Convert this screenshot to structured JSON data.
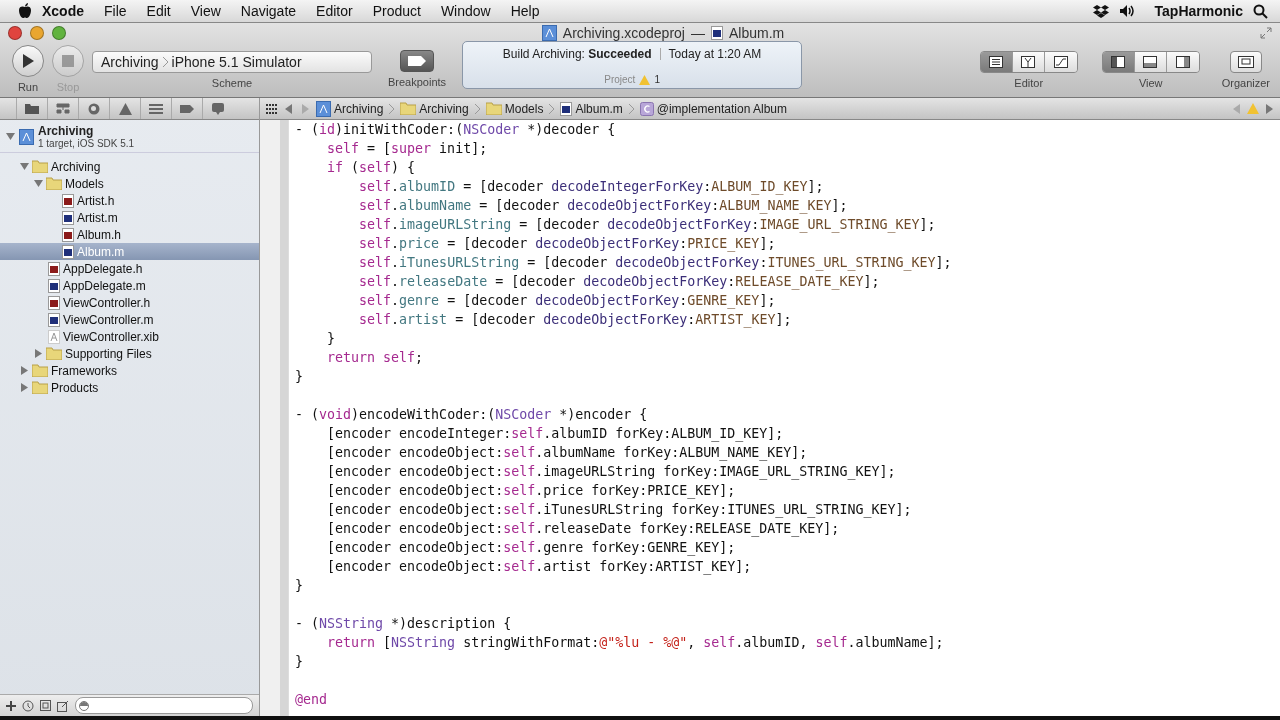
{
  "menu_bar": {
    "app": "Xcode",
    "items": [
      "File",
      "Edit",
      "View",
      "Navigate",
      "Editor",
      "Product",
      "Window",
      "Help"
    ],
    "user": "TapHarmonic"
  },
  "window": {
    "title": "Archiving.xcodeproj",
    "separator": "—",
    "file": "Album.m"
  },
  "toolbar": {
    "run": {
      "label": "Run",
      "disabled": false
    },
    "stop": {
      "label": "Stop",
      "disabled": true
    },
    "scheme": {
      "project": "Archiving",
      "destination": "iPhone 5.1 Simulator",
      "label": "Scheme"
    },
    "breakpoints": {
      "label": "Breakpoints"
    },
    "activity": {
      "prefix": "Build Archiving:",
      "status": "Succeeded",
      "time": "Today at 1:20 AM",
      "project": "Project",
      "warnings": "1"
    },
    "editor": {
      "label": "Editor",
      "segments": [
        {
          "kind": "standard",
          "selected": true
        },
        {
          "kind": "assistant",
          "selected": false
        },
        {
          "kind": "version",
          "selected": false
        }
      ]
    },
    "view": {
      "label": "View",
      "segments": [
        {
          "kind": "left",
          "selected": true
        },
        {
          "kind": "bottom",
          "selected": false
        },
        {
          "kind": "right",
          "selected": false
        }
      ]
    },
    "organizer": {
      "label": "Organizer"
    }
  },
  "jump_bar": {
    "crumbs": [
      {
        "kind": "project",
        "label": "Archiving"
      },
      {
        "kind": "folder",
        "label": "Archiving"
      },
      {
        "kind": "folder",
        "label": "Models"
      },
      {
        "kind": "m",
        "label": "Album.m"
      },
      {
        "kind": "class",
        "label": "@implementation Album"
      }
    ]
  },
  "navigator": {
    "project": {
      "name": "Archiving",
      "subtitle": "1 target, iOS SDK 5.1",
      "expanded": true
    },
    "tree": [
      {
        "kind": "folder",
        "label": "Archiving",
        "expanded": true,
        "selected": false,
        "children": [
          {
            "kind": "folder",
            "label": "Models",
            "expanded": true,
            "selected": false,
            "children": [
              {
                "kind": "h",
                "label": "Artist.h",
                "selected": false
              },
              {
                "kind": "m",
                "label": "Artist.m",
                "selected": false
              },
              {
                "kind": "h",
                "label": "Album.h",
                "selected": false
              },
              {
                "kind": "m",
                "label": "Album.m",
                "selected": true
              }
            ]
          },
          {
            "kind": "h",
            "label": "AppDelegate.h",
            "selected": false
          },
          {
            "kind": "m",
            "label": "AppDelegate.m",
            "selected": false
          },
          {
            "kind": "h",
            "label": "ViewController.h",
            "selected": false
          },
          {
            "kind": "m",
            "label": "ViewController.m",
            "selected": false
          },
          {
            "kind": "xib",
            "label": "ViewController.xib",
            "selected": false
          },
          {
            "kind": "folder",
            "label": "Supporting Files",
            "expanded": false,
            "selected": false
          }
        ]
      },
      {
        "kind": "folder",
        "label": "Frameworks",
        "expanded": false,
        "selected": false
      },
      {
        "kind": "folder",
        "label": "Products",
        "expanded": false,
        "selected": false
      }
    ]
  },
  "code": {
    "blocks": [
      {
        "lines": [
          [
            {
              "kind": "plain",
              "text": "- ("
            },
            {
              "kind": "keyword",
              "text": "id"
            },
            {
              "kind": "plain",
              "text": ")initWithCoder:("
            },
            {
              "kind": "type",
              "text": "NSCoder"
            },
            {
              "kind": "plain",
              "text": " *)decoder {"
            }
          ],
          [
            {
              "kind": "keyword",
              "text": "    self"
            },
            {
              "kind": "plain",
              "text": " = ["
            },
            {
              "kind": "keyword",
              "text": "super"
            },
            {
              "kind": "plain",
              "text": " init];"
            }
          ],
          [
            {
              "kind": "keyword",
              "text": "    if"
            },
            {
              "kind": "plain",
              "text": " ("
            },
            {
              "kind": "keyword",
              "text": "self"
            },
            {
              "kind": "plain",
              "text": ") {"
            }
          ],
          [
            {
              "kind": "keyword",
              "text": "        self"
            },
            {
              "kind": "plain",
              "text": "."
            },
            {
              "kind": "property",
              "text": "albumID"
            },
            {
              "kind": "plain",
              "text": " = [decoder "
            },
            {
              "kind": "method",
              "text": "decodeIntegerForKey"
            },
            {
              "kind": "plain",
              "text": ":"
            },
            {
              "kind": "constant",
              "text": "ALBUM_ID_KEY"
            },
            {
              "kind": "plain",
              "text": "];"
            }
          ],
          [
            {
              "kind": "keyword",
              "text": "        self"
            },
            {
              "kind": "plain",
              "text": "."
            },
            {
              "kind": "property",
              "text": "albumName"
            },
            {
              "kind": "plain",
              "text": " = [decoder "
            },
            {
              "kind": "method",
              "text": "decodeObjectForKey"
            },
            {
              "kind": "plain",
              "text": ":"
            },
            {
              "kind": "constant",
              "text": "ALBUM_NAME_KEY"
            },
            {
              "kind": "plain",
              "text": "];"
            }
          ],
          [
            {
              "kind": "keyword",
              "text": "        self"
            },
            {
              "kind": "plain",
              "text": "."
            },
            {
              "kind": "property",
              "text": "imageURLString"
            },
            {
              "kind": "plain",
              "text": " = [decoder "
            },
            {
              "kind": "method",
              "text": "decodeObjectForKey"
            },
            {
              "kind": "plain",
              "text": ":"
            },
            {
              "kind": "constant",
              "text": "IMAGE_URL_STRING_KEY"
            },
            {
              "kind": "plain",
              "text": "];"
            }
          ],
          [
            {
              "kind": "keyword",
              "text": "        self"
            },
            {
              "kind": "plain",
              "text": "."
            },
            {
              "kind": "property",
              "text": "price"
            },
            {
              "kind": "plain",
              "text": " = [decoder "
            },
            {
              "kind": "method",
              "text": "decodeObjectForKey"
            },
            {
              "kind": "plain",
              "text": ":"
            },
            {
              "kind": "constant",
              "text": "PRICE_KEY"
            },
            {
              "kind": "plain",
              "text": "];"
            }
          ],
          [
            {
              "kind": "keyword",
              "text": "        self"
            },
            {
              "kind": "plain",
              "text": "."
            },
            {
              "kind": "property",
              "text": "iTunesURLString"
            },
            {
              "kind": "plain",
              "text": " = [decoder "
            },
            {
              "kind": "method",
              "text": "decodeObjectForKey"
            },
            {
              "kind": "plain",
              "text": ":"
            },
            {
              "kind": "constant",
              "text": "ITUNES_URL_STRING_KEY"
            },
            {
              "kind": "plain",
              "text": "];"
            }
          ],
          [
            {
              "kind": "keyword",
              "text": "        self"
            },
            {
              "kind": "plain",
              "text": "."
            },
            {
              "kind": "property",
              "text": "releaseDate"
            },
            {
              "kind": "plain",
              "text": " = [decoder "
            },
            {
              "kind": "method",
              "text": "decodeObjectForKey"
            },
            {
              "kind": "plain",
              "text": ":"
            },
            {
              "kind": "constant",
              "text": "RELEASE_DATE_KEY"
            },
            {
              "kind": "plain",
              "text": "];"
            }
          ],
          [
            {
              "kind": "keyword",
              "text": "        self"
            },
            {
              "kind": "plain",
              "text": "."
            },
            {
              "kind": "property",
              "text": "genre"
            },
            {
              "kind": "plain",
              "text": " = [decoder "
            },
            {
              "kind": "method",
              "text": "decodeObjectForKey"
            },
            {
              "kind": "plain",
              "text": ":"
            },
            {
              "kind": "constant",
              "text": "GENRE_KEY"
            },
            {
              "kind": "plain",
              "text": "];"
            }
          ],
          [
            {
              "kind": "keyword",
              "text": "        self"
            },
            {
              "kind": "plain",
              "text": "."
            },
            {
              "kind": "property",
              "text": "artist"
            },
            {
              "kind": "plain",
              "text": " = [decoder "
            },
            {
              "kind": "method",
              "text": "decodeObjectForKey"
            },
            {
              "kind": "plain",
              "text": ":"
            },
            {
              "kind": "constant",
              "text": "ARTIST_KEY"
            },
            {
              "kind": "plain",
              "text": "];"
            }
          ],
          [
            {
              "kind": "plain",
              "text": "    }"
            }
          ],
          [
            {
              "kind": "keyword",
              "text": "    return"
            },
            {
              "kind": "keyword",
              "text": " self"
            },
            {
              "kind": "plain",
              "text": ";"
            }
          ],
          [
            {
              "kind": "plain",
              "text": "}"
            }
          ]
        ]
      },
      {
        "lines": [
          [
            {
              "kind": "plain",
              "text": "- ("
            },
            {
              "kind": "keyword",
              "text": "void"
            },
            {
              "kind": "plain",
              "text": ")encodeWithCoder:("
            },
            {
              "kind": "type",
              "text": "NSCoder"
            },
            {
              "kind": "plain",
              "text": " *)encoder {"
            }
          ],
          [
            {
              "kind": "plain",
              "text": "    [encoder encodeInteger:"
            },
            {
              "kind": "keyword",
              "text": "self"
            },
            {
              "kind": "plain",
              "text": ".albumID forKey:ALBUM_ID_KEY];"
            }
          ],
          [
            {
              "kind": "plain",
              "text": "    [encoder encodeObject:"
            },
            {
              "kind": "keyword",
              "text": "self"
            },
            {
              "kind": "plain",
              "text": ".albumName forKey:ALBUM_NAME_KEY];"
            }
          ],
          [
            {
              "kind": "plain",
              "text": "    [encoder encodeObject:"
            },
            {
              "kind": "keyword",
              "text": "self"
            },
            {
              "kind": "plain",
              "text": ".imageURLString forKey:IMAGE_URL_STRING_KEY];"
            }
          ],
          [
            {
              "kind": "plain",
              "text": "    [encoder encodeObject:"
            },
            {
              "kind": "keyword",
              "text": "self"
            },
            {
              "kind": "plain",
              "text": ".price forKey:PRICE_KEY];"
            }
          ],
          [
            {
              "kind": "plain",
              "text": "    [encoder encodeObject:"
            },
            {
              "kind": "keyword",
              "text": "self"
            },
            {
              "kind": "plain",
              "text": ".iTunesURLString forKey:ITUNES_URL_STRING_KEY];"
            }
          ],
          [
            {
              "kind": "plain",
              "text": "    [encoder encodeObject:"
            },
            {
              "kind": "keyword",
              "text": "self"
            },
            {
              "kind": "plain",
              "text": ".releaseDate forKey:RELEASE_DATE_KEY];"
            }
          ],
          [
            {
              "kind": "plain",
              "text": "    [encoder encodeObject:"
            },
            {
              "kind": "keyword",
              "text": "self"
            },
            {
              "kind": "plain",
              "text": ".genre forKey:GENRE_KEY];"
            }
          ],
          [
            {
              "kind": "plain",
              "text": "    [encoder encodeObject:"
            },
            {
              "kind": "keyword",
              "text": "self"
            },
            {
              "kind": "plain",
              "text": ".artist forKey:ARTIST_KEY];"
            }
          ],
          [
            {
              "kind": "plain",
              "text": "}"
            }
          ]
        ]
      },
      {
        "lines": [
          [
            {
              "kind": "plain",
              "text": "- ("
            },
            {
              "kind": "type",
              "text": "NSString"
            },
            {
              "kind": "plain",
              "text": " *)description {"
            }
          ],
          [
            {
              "kind": "keyword",
              "text": "    return"
            },
            {
              "kind": "plain",
              "text": " ["
            },
            {
              "kind": "type",
              "text": "NSString"
            },
            {
              "kind": "plain",
              "text": " stringWithFormat:"
            },
            {
              "kind": "string",
              "text": "@\"%lu - %@\""
            },
            {
              "kind": "plain",
              "text": ", "
            },
            {
              "kind": "keyword",
              "text": "self"
            },
            {
              "kind": "plain",
              "text": ".albumID, "
            },
            {
              "kind": "keyword",
              "text": "self"
            },
            {
              "kind": "plain",
              "text": ".albumName];"
            }
          ],
          [
            {
              "kind": "plain",
              "text": "}"
            }
          ]
        ]
      },
      {
        "lines": [
          [
            {
              "kind": "keyword",
              "text": "@end"
            }
          ]
        ]
      }
    ]
  }
}
